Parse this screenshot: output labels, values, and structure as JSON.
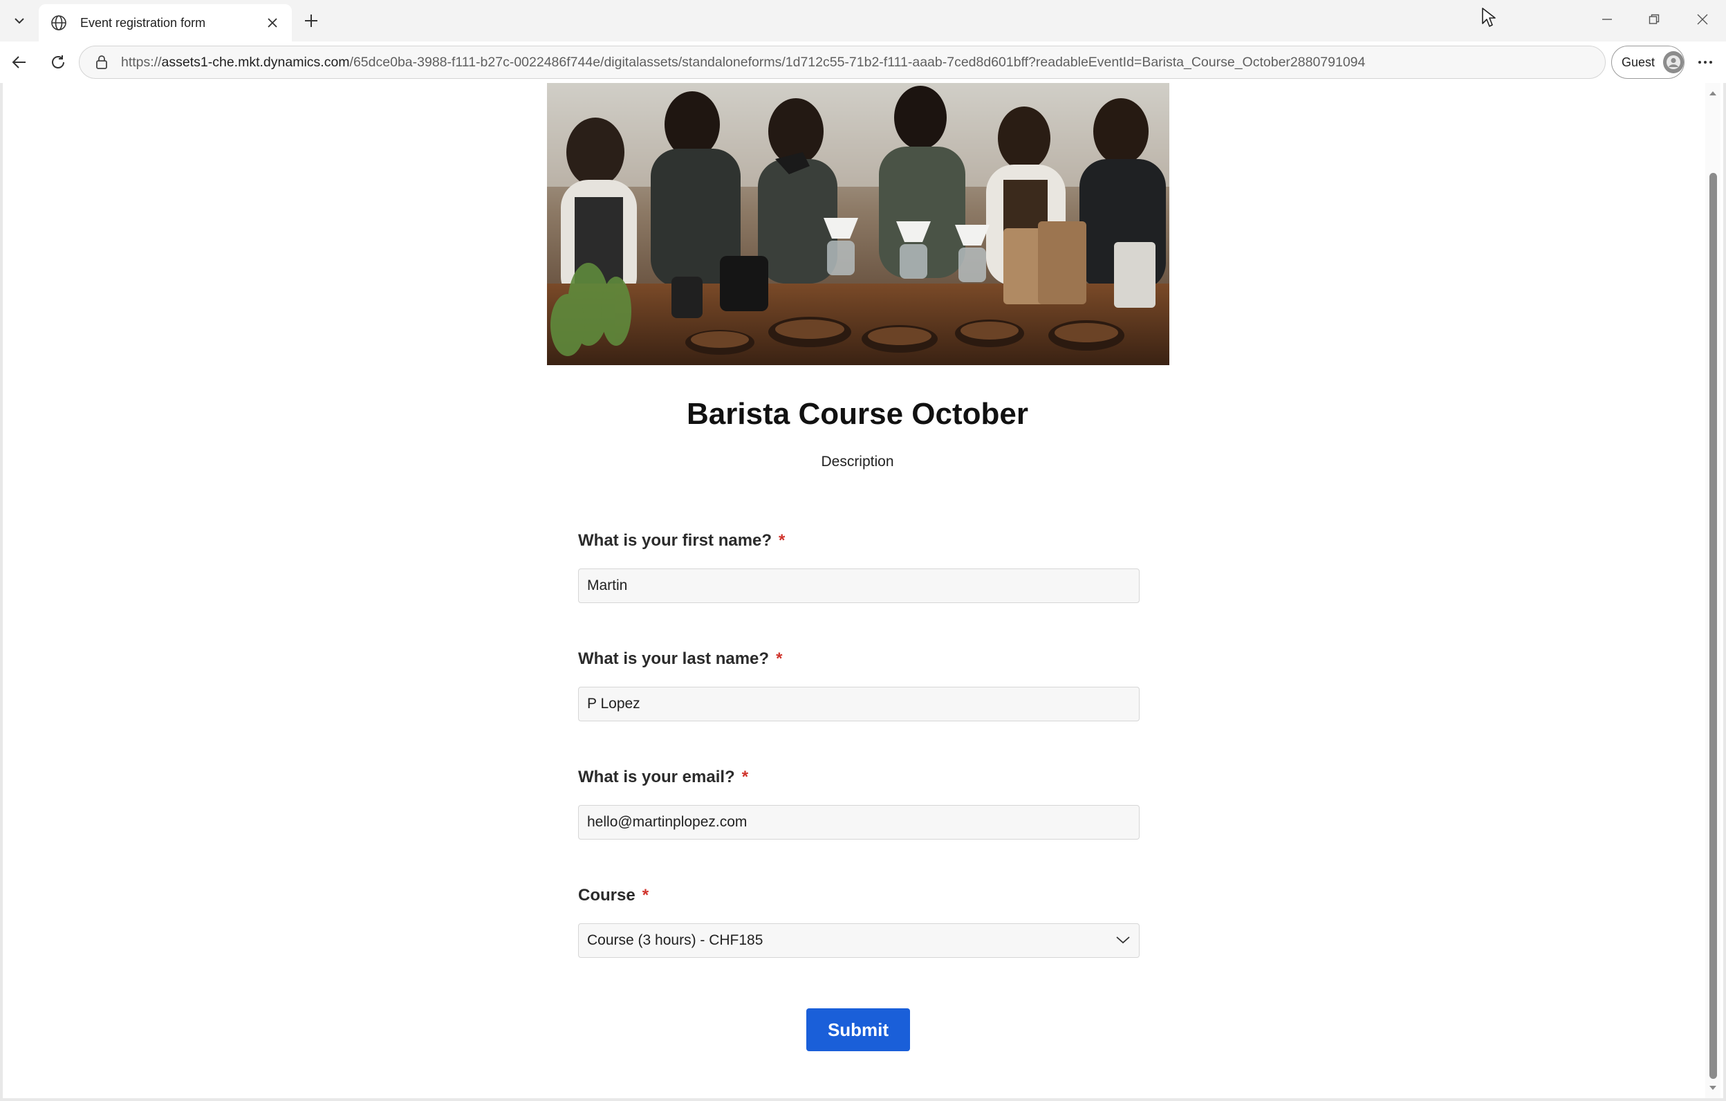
{
  "browser": {
    "tab_title": "Event registration form",
    "url_prefix": "https://",
    "url_host": "assets1-che.mkt.dynamics.com",
    "url_path": "/65dce0ba-3988-f111-b27c-0022486f744e/digitalassets/standaloneforms/1d712c55-71b2-f111-aaab-7ced8d601bff?readableEventId=Barista_Course_October2880791094",
    "profile_label": "Guest"
  },
  "event": {
    "title": "Barista Course October",
    "description": "Description"
  },
  "form": {
    "first_name": {
      "label": "What is your first name?",
      "required_mark": "*",
      "value": "Martin"
    },
    "last_name": {
      "label": "What is your last name?",
      "required_mark": "*",
      "value": "P Lopez"
    },
    "email": {
      "label": "What is your email?",
      "required_mark": "*",
      "value": "hello@martinplopez.com"
    },
    "course": {
      "label": "Course",
      "required_mark": "*",
      "selected": "Course (3 hours) - CHF185"
    },
    "submit_label": "Submit"
  },
  "icons": {
    "tab_favicon": "globe-icon",
    "tab_close": "close-icon",
    "new_tab": "plus-icon",
    "back": "back-arrow-icon",
    "refresh": "refresh-icon",
    "site_info": "lock-icon",
    "more": "ellipsis-icon",
    "select_chevron": "chevron-down-icon"
  },
  "colors": {
    "submit_bg": "#1a5fd9",
    "required_mark": "#d0342c"
  }
}
